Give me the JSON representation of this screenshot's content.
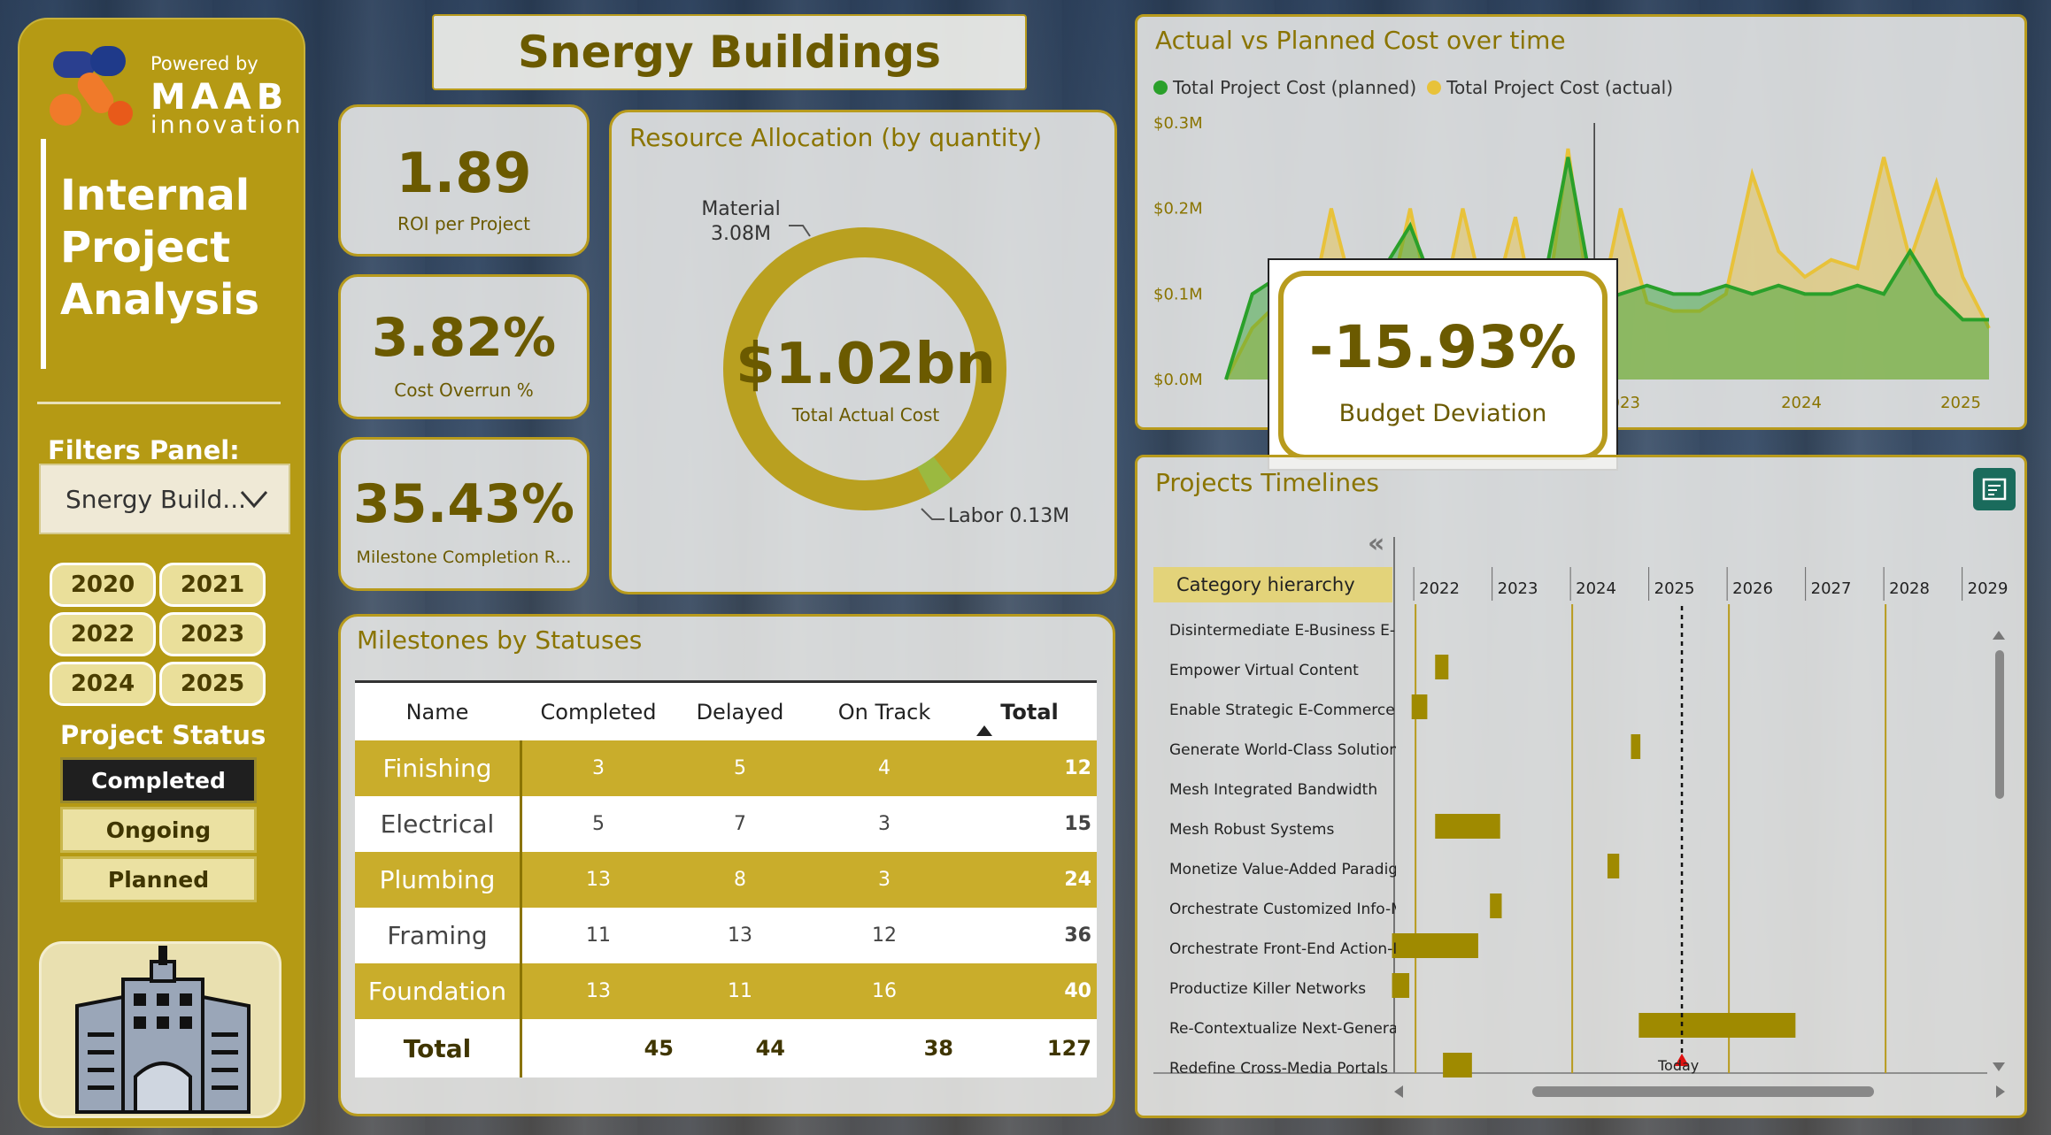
{
  "sidebar": {
    "logo": {
      "powered_by": "Powered by",
      "name": "MAAB",
      "sub": "innovation"
    },
    "title_lines": [
      "Internal",
      "Project",
      "Analysis"
    ],
    "filters_label": "Filters Panel:",
    "dropdown_value": "Snergy Build...",
    "years": [
      "2020",
      "2021",
      "2022",
      "2023",
      "2024",
      "2025"
    ],
    "status_label": "Project Status",
    "statuses": [
      {
        "label": "Completed",
        "selected": true
      },
      {
        "label": "Ongoing",
        "selected": false
      },
      {
        "label": "Planned",
        "selected": false
      }
    ]
  },
  "header": {
    "title": "Snergy Buildings"
  },
  "kpis": [
    {
      "value": "1.89",
      "label": "ROI per Project"
    },
    {
      "value": "3.82%",
      "label": "Cost Overrun %"
    },
    {
      "value": "35.43%",
      "label": "Milestone Completion R..."
    }
  ],
  "resource": {
    "title": "Resource Allocation (by quantity)",
    "center_value": "$1.02bn",
    "center_label": "Total Actual Cost",
    "material_label": "Material",
    "material_value": "3.08M",
    "labor_label": "Labor 0.13M",
    "colors": {
      "material": "#b9a020",
      "labor": "#9bb940"
    }
  },
  "chart_data": {
    "type": "area",
    "title": "Actual vs Planned Cost over time",
    "y_ticks": [
      "$0.3M",
      "$0.2M",
      "$0.1M",
      "$0.0M"
    ],
    "x_ticks": [
      "2023",
      "2024",
      "2025"
    ],
    "ylim": [
      0,
      0.3
    ],
    "series": [
      {
        "name": "Total Project Cost (planned)",
        "color": "#2aa02a",
        "values": [
          0.0,
          0.1,
          0.12,
          0.06,
          0.07,
          0.11,
          0.13,
          0.18,
          0.1,
          0.05,
          0.09,
          0.12,
          0.1,
          0.26,
          0.09,
          0.1,
          0.11,
          0.1,
          0.1,
          0.11,
          0.1,
          0.11,
          0.1,
          0.1,
          0.11,
          0.1,
          0.15,
          0.1,
          0.07,
          0.07
        ]
      },
      {
        "name": "Total Project Cost (actual)",
        "color": "#e8c23a",
        "values": [
          0.0,
          0.06,
          0.09,
          0.05,
          0.2,
          0.08,
          0.06,
          0.2,
          0.05,
          0.2,
          0.07,
          0.19,
          0.04,
          0.27,
          0.05,
          0.2,
          0.09,
          0.08,
          0.08,
          0.1,
          0.24,
          0.15,
          0.12,
          0.14,
          0.13,
          0.26,
          0.14,
          0.23,
          0.12,
          0.06
        ]
      }
    ]
  },
  "budget": {
    "value": "-15.93%",
    "label": "Budget Deviation"
  },
  "milestones": {
    "title": "Milestones by Statuses",
    "headers": [
      "Name",
      "Completed",
      "Delayed",
      "On Track",
      "Total"
    ],
    "rows": [
      {
        "name": "Finishing",
        "completed": "3",
        "delayed": "5",
        "on_track": "4",
        "total": "12"
      },
      {
        "name": "Electrical",
        "completed": "5",
        "delayed": "7",
        "on_track": "3",
        "total": "15"
      },
      {
        "name": "Plumbing",
        "completed": "13",
        "delayed": "8",
        "on_track": "3",
        "total": "24"
      },
      {
        "name": "Framing",
        "completed": "11",
        "delayed": "13",
        "on_track": "12",
        "total": "36"
      },
      {
        "name": "Foundation",
        "completed": "13",
        "delayed": "11",
        "on_track": "16",
        "total": "40"
      }
    ],
    "total_row": {
      "name": "Total",
      "completed": "45",
      "delayed": "44",
      "on_track": "38",
      "total": "127"
    }
  },
  "timeline": {
    "title": "Projects Timelines",
    "hierarchy_label": "Category hierarchy",
    "years": [
      "2022",
      "2023",
      "2024",
      "2025",
      "2026",
      "2027",
      "2028",
      "2029"
    ],
    "today_label": "Today",
    "projects": [
      {
        "name": "Disintermediate E-Business E-S",
        "start": null,
        "end": null
      },
      {
        "name": "Empower Virtual Content",
        "start": 2022.25,
        "end": 2022.42
      },
      {
        "name": "Enable Strategic E-Commerce",
        "start": 2021.95,
        "end": 2022.15
      },
      {
        "name": "Generate World-Class Solutions",
        "start": 2024.75,
        "end": 2024.87
      },
      {
        "name": "Mesh Integrated Bandwidth",
        "start": null,
        "end": null
      },
      {
        "name": "Mesh Robust Systems",
        "start": 2022.25,
        "end": 2023.08
      },
      {
        "name": "Monetize Value-Added Paradigm",
        "start": 2024.45,
        "end": 2024.6
      },
      {
        "name": "Orchestrate Customized Info-Me",
        "start": 2022.95,
        "end": 2023.1
      },
      {
        "name": "Orchestrate Front-End Action-Ite",
        "start": 2021.7,
        "end": 2022.8
      },
      {
        "name": "Productize Killer Networks",
        "start": 2021.7,
        "end": 2021.92
      },
      {
        "name": "Re-Contextualize Next-Generat",
        "start": 2024.85,
        "end": 2026.85
      },
      {
        "name": "Redefine Cross-Media Portals",
        "start": 2022.35,
        "end": 2022.72
      }
    ],
    "today_value": 2025.4
  }
}
